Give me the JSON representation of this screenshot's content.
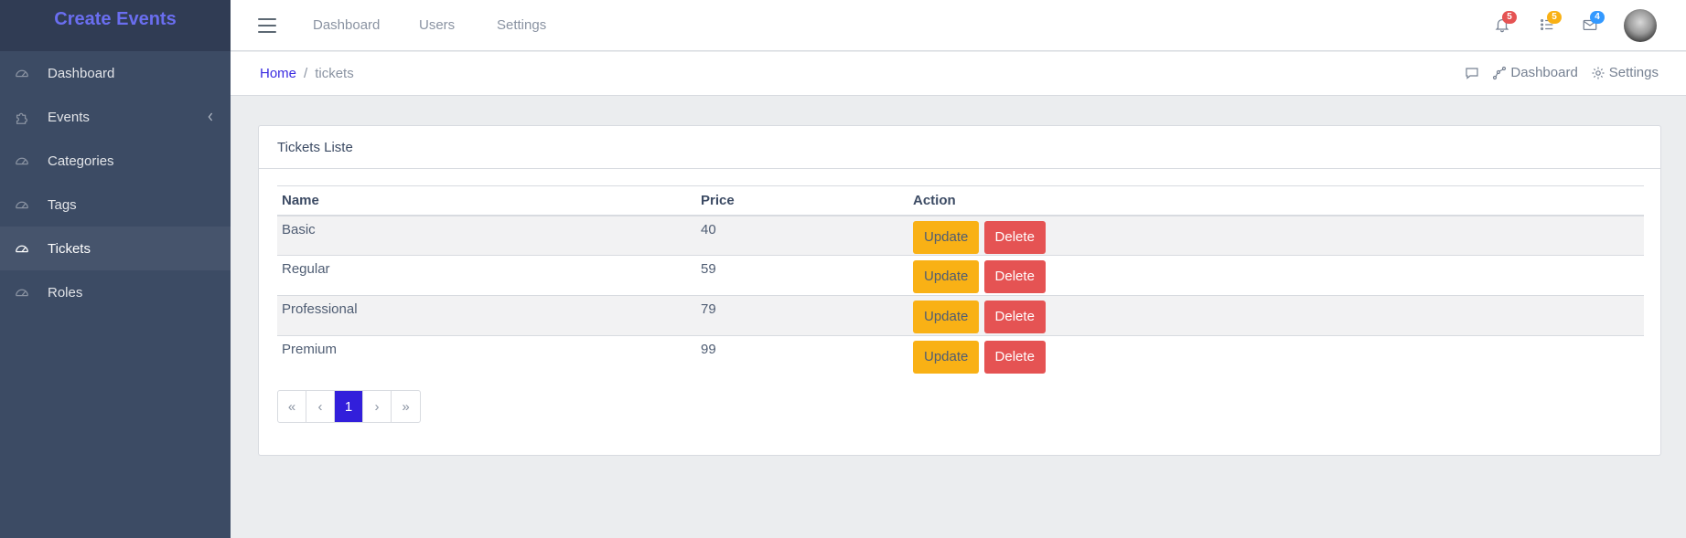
{
  "sidebar": {
    "brand": "Create Events",
    "items": [
      {
        "label": "Dashboard",
        "icon": "speedometer-icon"
      },
      {
        "label": "Events",
        "icon": "puzzle-icon"
      },
      {
        "label": "Categories",
        "icon": "speedometer-icon"
      },
      {
        "label": "Tags",
        "icon": "speedometer-icon"
      },
      {
        "label": "Tickets",
        "icon": "speedometer-icon"
      },
      {
        "label": "Roles",
        "icon": "speedometer-icon"
      }
    ]
  },
  "header": {
    "nav": [
      "Dashboard",
      "Users",
      "Settings"
    ],
    "badges": {
      "notifications": "5",
      "tasks": "5",
      "messages": "4"
    },
    "colors": {
      "notifications": "#e55353",
      "tasks": "#f9b115",
      "messages": "#39f"
    }
  },
  "breadcrumb": {
    "home": "Home",
    "separator": "/",
    "current": "tickets"
  },
  "subheader": {
    "dashboard": "Dashboard",
    "settings": "Settings"
  },
  "card": {
    "title": "Tickets Liste",
    "columns": [
      "Name",
      "Price",
      "Action"
    ],
    "rows": [
      {
        "name": "Basic",
        "price": "40"
      },
      {
        "name": "Regular",
        "price": "59"
      },
      {
        "name": "Professional",
        "price": "79"
      },
      {
        "name": "Premium",
        "price": "99"
      }
    ],
    "update_label": "Update",
    "delete_label": "Delete"
  },
  "pagination": {
    "first": "«",
    "prev": "‹",
    "current": "1",
    "next": "›",
    "last": "»"
  }
}
